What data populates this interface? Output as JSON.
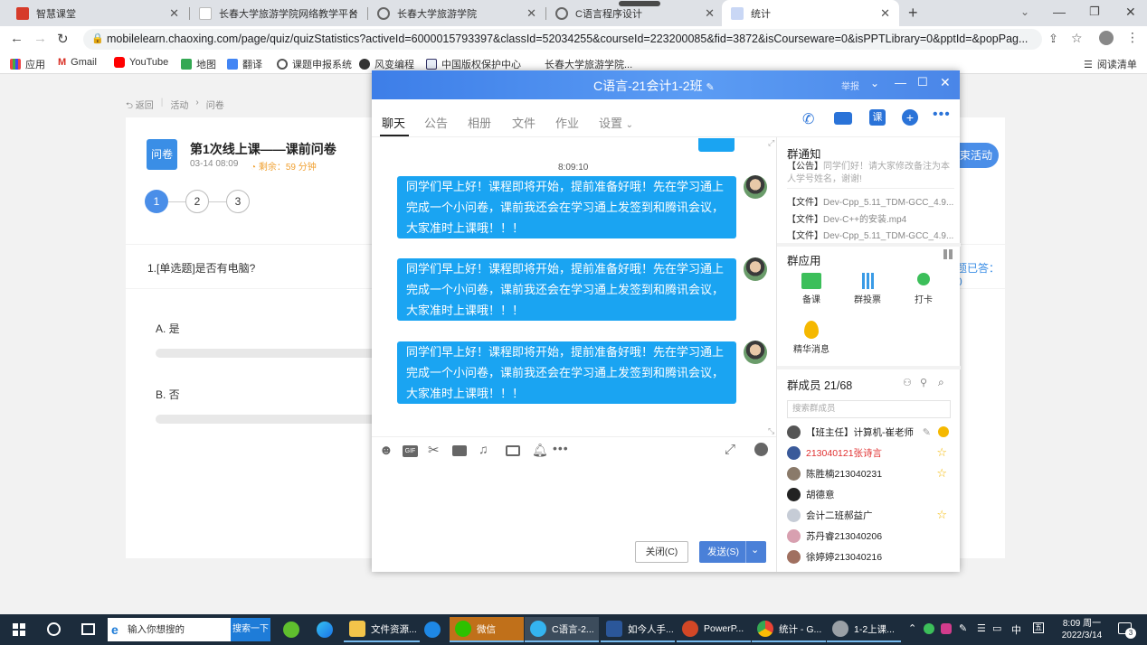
{
  "browser": {
    "tabs": [
      {
        "title": "智慧课堂",
        "color": "#d63b2a"
      },
      {
        "title": "长春大学旅游学院网络教学平台",
        "color": "#ffffff"
      },
      {
        "title": "长春大学旅游学院",
        "color": "#777777"
      },
      {
        "title": "C语言程序设计",
        "color": "#777777"
      },
      {
        "title": "统计",
        "color": "#c9d7f5"
      }
    ],
    "new_tab": "+",
    "url": "mobilelearn.chaoxing.com/page/quiz/quizStatistics?activeId=6000015793397&classId=52034255&courseId=223200085&fid=3872&isCourseware=0&isPPTLibrary=0&pptId=&popPag...",
    "bookmarks": [
      "应用",
      "Gmail",
      "YouTube",
      "地图",
      "翻译",
      "课题申报系统",
      "风变编程",
      "中国版权保护中心",
      "长春大学旅游学院..."
    ],
    "reading_list": "阅读清单"
  },
  "quiz_page": {
    "breadcrumb": {
      "back": "返回",
      "activity": "活动",
      "survey": "问卷"
    },
    "badge": "问卷",
    "title": "第1次线上课——课前问卷",
    "date": "03-14 08:09",
    "remaining": "剩余：59 分钟",
    "steps": [
      "1",
      "2",
      "3"
    ],
    "question": "1.[单选题]是否有电脑?",
    "answered": "题已答：0",
    "options": [
      "A. 是",
      "B. 否"
    ],
    "action_button": "束活动"
  },
  "chat": {
    "title": "C语言-21会计1-2班",
    "title_extra": "举报",
    "nav": [
      "聊天",
      "公告",
      "相册",
      "文件",
      "作业",
      "设置"
    ],
    "timestamp": "8:09:10",
    "messages": [
      {
        "lines": [
          "同学们早上好！课程即将开始，提前准备好哦！先在学习通上",
          "完成一个小问卷，课前我还会在学习通上发签到和腾讯会议，",
          "大家准时上课哦！！！"
        ]
      },
      {
        "lines": [
          "同学们早上好！课程即将开始，提前准备好哦！先在学习通上",
          "完成一个小问卷，课前我还会在学习通上发签到和腾讯会议，",
          "大家准时上课哦！！！"
        ]
      },
      {
        "lines": [
          "同学们早上好！课程即将开始，提前准备好哦！先在学习通上",
          "完成一个小问卷，课前我还会在学习通上发签到和腾讯会议，",
          "大家准时上课哦！！！"
        ]
      }
    ],
    "close_button": "关闭(C)",
    "send_button": "发送(S)",
    "side": {
      "notice_title": "群通知",
      "notice_tag": "【公告】",
      "notice_text": "同学们好！请大家修改备注为本人学号姓名，谢谢!",
      "files": [
        {
          "tag": "【文件】",
          "name": "Dev-Cpp_5.11_TDM-GCC_4.9..."
        },
        {
          "tag": "【文件】",
          "name": "Dev-C++的安装.mp4"
        },
        {
          "tag": "【文件】",
          "name": "Dev-Cpp_5.11_TDM-GCC_4.9..."
        }
      ],
      "apps_title": "群应用",
      "apps": [
        "备课",
        "群投票",
        "打卡",
        "精华消息"
      ],
      "members_title": "群成员 21/68",
      "search_placeholder": "搜索群成员",
      "members": [
        {
          "name": "【班主任】计算机-崔老师",
          "color": "#222222"
        },
        {
          "name": "213040121张诗言",
          "color": "#e03030"
        },
        {
          "name": "陈胜楠213040231",
          "color": "#222222"
        },
        {
          "name": "胡德意",
          "color": "#222222"
        },
        {
          "name": "会计二班郝益广",
          "color": "#222222"
        },
        {
          "name": "苏丹睿213040206",
          "color": "#222222"
        },
        {
          "name": "徐婷婷213040216",
          "color": "#222222"
        }
      ]
    }
  },
  "taskbar": {
    "search_placeholder": "输入你想搜的",
    "search_button": "搜索一下",
    "apps": [
      "文件资源...",
      "微信",
      "C语言-2...",
      "如今人手...",
      "PowerP...",
      "统计 - G...",
      "1-2上课..."
    ],
    "ime": "中",
    "time": "8:09 周一",
    "date": "2022/3/14",
    "notifications": "3"
  }
}
